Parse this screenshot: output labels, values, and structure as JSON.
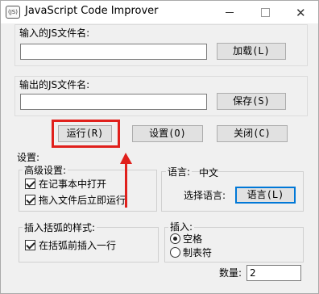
{
  "window": {
    "app_icon_text": "(JS)",
    "title": "JavaScript Code Improver",
    "controls": {
      "minimize": "minimize-icon",
      "maximize": "maximize-icon",
      "close": "✕"
    }
  },
  "input_section": {
    "label": "输入的JS文件名:",
    "value": "",
    "load_button": "加载(L)"
  },
  "output_section": {
    "label": "输出的JS文件名:",
    "value": "",
    "save_button": "保存(S)"
  },
  "actions": {
    "run_button": "运行(R)",
    "settings_button": "设置(O)",
    "close_button": "关闭(C)"
  },
  "settings": {
    "title": "设置:",
    "advanced": {
      "title": "高级设置:",
      "open_in_notepad": "在记事本中打开",
      "run_after_drag": "拖入文件后立即运行"
    },
    "language": {
      "title": "语言:",
      "current": "中文",
      "select_label": "选择语言:",
      "select_button": "语言(L)"
    },
    "bracket_style": {
      "title": "插入括弧的样式:",
      "insert_before": "在括弧前插入一行"
    },
    "insert": {
      "title": "插入:",
      "option_space": "空格",
      "option_tab": "制表符",
      "selected": "空格"
    },
    "count": {
      "label": "数量:",
      "value": "2"
    }
  },
  "annotation": {
    "color": "#e0201c"
  }
}
